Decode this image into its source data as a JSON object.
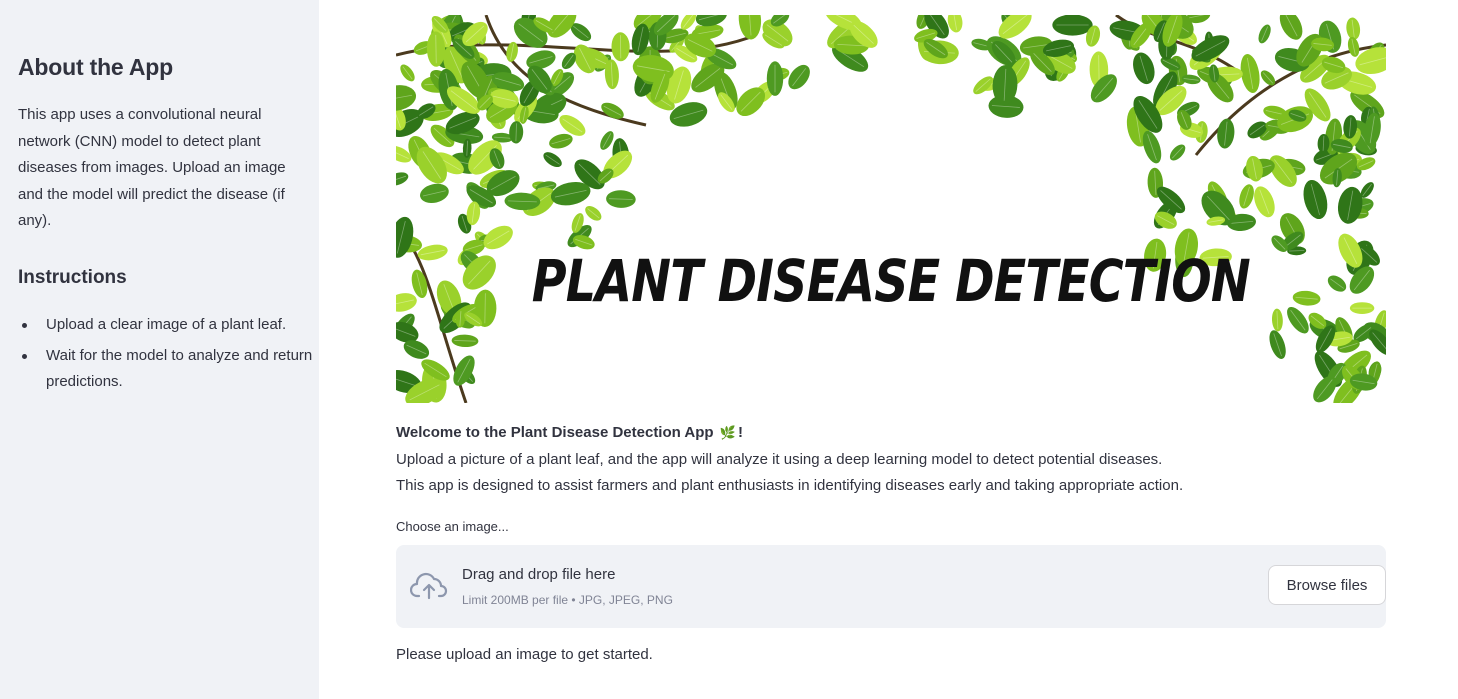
{
  "sidebar": {
    "about_title": "About the App",
    "about_text": "This app uses a convolutional neural network (CNN) model to detect plant diseases from images. Upload an image and the model will predict the disease (if any).",
    "instructions_title": "Instructions",
    "instructions": [
      "Upload a clear image of a plant leaf.",
      "Wait for the model to analyze and return predictions."
    ]
  },
  "banner": {
    "title": "PLANT DISEASE DETECTION"
  },
  "welcome": {
    "heading": "Welcome to the Plant Disease Detection App",
    "heading_suffix": "!",
    "emoji": "🌿",
    "line1": "Upload a picture of a plant leaf, and the app will analyze it using a deep learning model to detect potential diseases.",
    "line2": "This app is designed to assist farmers and plant enthusiasts in identifying diseases early and taking appropriate action."
  },
  "uploader": {
    "label": "Choose an image...",
    "drag_text": "Drag and drop file here",
    "limit_text": "Limit 200MB per file • JPG, JPEG, PNG",
    "browse_label": "Browse files",
    "icon": "cloud-upload-icon"
  },
  "status": {
    "message": "Please upload an image to get started."
  },
  "colors": {
    "sidebar_bg": "#f0f2f6",
    "text": "#31333f",
    "leaf_light": "#9ad12b",
    "leaf_dark": "#3f8a1e"
  }
}
